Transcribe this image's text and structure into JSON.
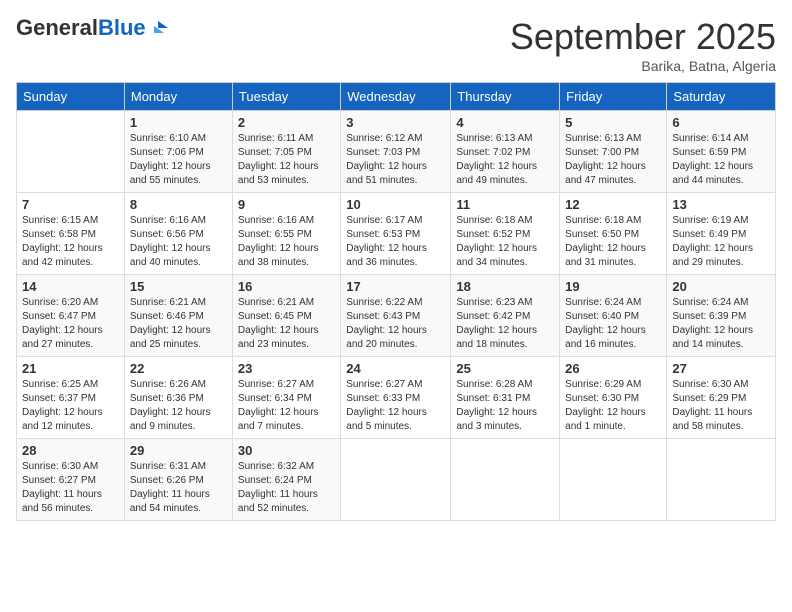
{
  "header": {
    "logo_general": "General",
    "logo_blue": "Blue",
    "month": "September 2025",
    "location": "Barika, Batna, Algeria"
  },
  "weekdays": [
    "Sunday",
    "Monday",
    "Tuesday",
    "Wednesday",
    "Thursday",
    "Friday",
    "Saturday"
  ],
  "weeks": [
    [
      {
        "day": "",
        "info": ""
      },
      {
        "day": "1",
        "info": "Sunrise: 6:10 AM\nSunset: 7:06 PM\nDaylight: 12 hours\nand 55 minutes."
      },
      {
        "day": "2",
        "info": "Sunrise: 6:11 AM\nSunset: 7:05 PM\nDaylight: 12 hours\nand 53 minutes."
      },
      {
        "day": "3",
        "info": "Sunrise: 6:12 AM\nSunset: 7:03 PM\nDaylight: 12 hours\nand 51 minutes."
      },
      {
        "day": "4",
        "info": "Sunrise: 6:13 AM\nSunset: 7:02 PM\nDaylight: 12 hours\nand 49 minutes."
      },
      {
        "day": "5",
        "info": "Sunrise: 6:13 AM\nSunset: 7:00 PM\nDaylight: 12 hours\nand 47 minutes."
      },
      {
        "day": "6",
        "info": "Sunrise: 6:14 AM\nSunset: 6:59 PM\nDaylight: 12 hours\nand 44 minutes."
      }
    ],
    [
      {
        "day": "7",
        "info": "Sunrise: 6:15 AM\nSunset: 6:58 PM\nDaylight: 12 hours\nand 42 minutes."
      },
      {
        "day": "8",
        "info": "Sunrise: 6:16 AM\nSunset: 6:56 PM\nDaylight: 12 hours\nand 40 minutes."
      },
      {
        "day": "9",
        "info": "Sunrise: 6:16 AM\nSunset: 6:55 PM\nDaylight: 12 hours\nand 38 minutes."
      },
      {
        "day": "10",
        "info": "Sunrise: 6:17 AM\nSunset: 6:53 PM\nDaylight: 12 hours\nand 36 minutes."
      },
      {
        "day": "11",
        "info": "Sunrise: 6:18 AM\nSunset: 6:52 PM\nDaylight: 12 hours\nand 34 minutes."
      },
      {
        "day": "12",
        "info": "Sunrise: 6:18 AM\nSunset: 6:50 PM\nDaylight: 12 hours\nand 31 minutes."
      },
      {
        "day": "13",
        "info": "Sunrise: 6:19 AM\nSunset: 6:49 PM\nDaylight: 12 hours\nand 29 minutes."
      }
    ],
    [
      {
        "day": "14",
        "info": "Sunrise: 6:20 AM\nSunset: 6:47 PM\nDaylight: 12 hours\nand 27 minutes."
      },
      {
        "day": "15",
        "info": "Sunrise: 6:21 AM\nSunset: 6:46 PM\nDaylight: 12 hours\nand 25 minutes."
      },
      {
        "day": "16",
        "info": "Sunrise: 6:21 AM\nSunset: 6:45 PM\nDaylight: 12 hours\nand 23 minutes."
      },
      {
        "day": "17",
        "info": "Sunrise: 6:22 AM\nSunset: 6:43 PM\nDaylight: 12 hours\nand 20 minutes."
      },
      {
        "day": "18",
        "info": "Sunrise: 6:23 AM\nSunset: 6:42 PM\nDaylight: 12 hours\nand 18 minutes."
      },
      {
        "day": "19",
        "info": "Sunrise: 6:24 AM\nSunset: 6:40 PM\nDaylight: 12 hours\nand 16 minutes."
      },
      {
        "day": "20",
        "info": "Sunrise: 6:24 AM\nSunset: 6:39 PM\nDaylight: 12 hours\nand 14 minutes."
      }
    ],
    [
      {
        "day": "21",
        "info": "Sunrise: 6:25 AM\nSunset: 6:37 PM\nDaylight: 12 hours\nand 12 minutes."
      },
      {
        "day": "22",
        "info": "Sunrise: 6:26 AM\nSunset: 6:36 PM\nDaylight: 12 hours\nand 9 minutes."
      },
      {
        "day": "23",
        "info": "Sunrise: 6:27 AM\nSunset: 6:34 PM\nDaylight: 12 hours\nand 7 minutes."
      },
      {
        "day": "24",
        "info": "Sunrise: 6:27 AM\nSunset: 6:33 PM\nDaylight: 12 hours\nand 5 minutes."
      },
      {
        "day": "25",
        "info": "Sunrise: 6:28 AM\nSunset: 6:31 PM\nDaylight: 12 hours\nand 3 minutes."
      },
      {
        "day": "26",
        "info": "Sunrise: 6:29 AM\nSunset: 6:30 PM\nDaylight: 12 hours\nand 1 minute."
      },
      {
        "day": "27",
        "info": "Sunrise: 6:30 AM\nSunset: 6:29 PM\nDaylight: 11 hours\nand 58 minutes."
      }
    ],
    [
      {
        "day": "28",
        "info": "Sunrise: 6:30 AM\nSunset: 6:27 PM\nDaylight: 11 hours\nand 56 minutes."
      },
      {
        "day": "29",
        "info": "Sunrise: 6:31 AM\nSunset: 6:26 PM\nDaylight: 11 hours\nand 54 minutes."
      },
      {
        "day": "30",
        "info": "Sunrise: 6:32 AM\nSunset: 6:24 PM\nDaylight: 11 hours\nand 52 minutes."
      },
      {
        "day": "",
        "info": ""
      },
      {
        "day": "",
        "info": ""
      },
      {
        "day": "",
        "info": ""
      },
      {
        "day": "",
        "info": ""
      }
    ]
  ]
}
